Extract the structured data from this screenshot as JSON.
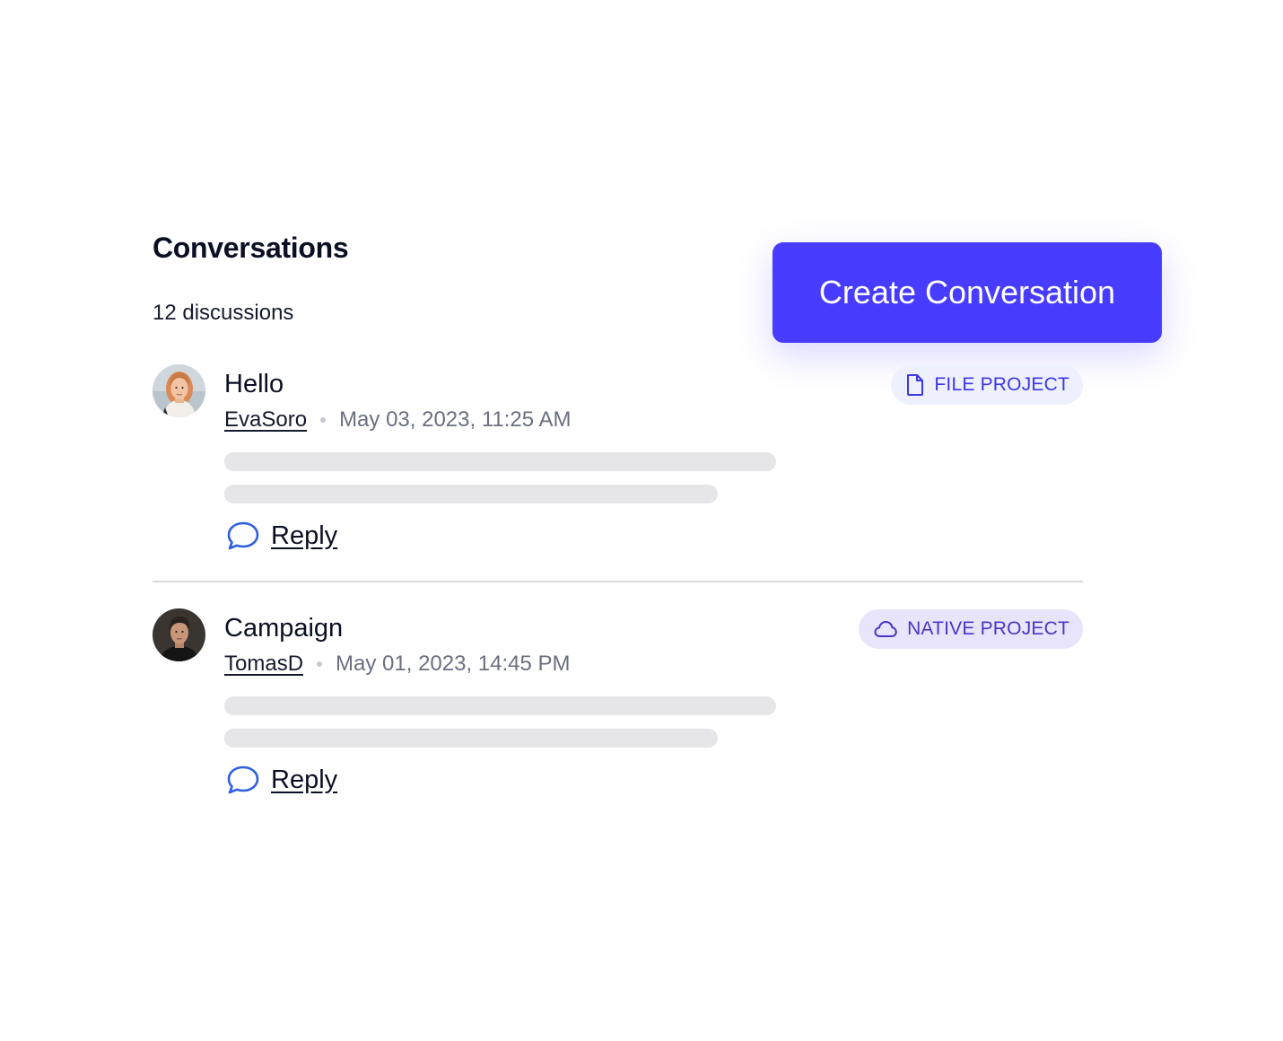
{
  "header": {
    "title": "Conversations",
    "count_label": "12 discussions",
    "create_button_label": "Create Conversation"
  },
  "colors": {
    "accent": "#473cff",
    "badge_file_bg": "#eef0fd",
    "badge_native_bg": "#e8e4fb",
    "reply_icon": "#2f5fe0",
    "skeleton": "#e6e6e8"
  },
  "conversations": [
    {
      "title": "Hello",
      "author": "EvaSoro",
      "timestamp": "May 03, 2023, 11:25 AM",
      "badge": {
        "label": "FILE PROJECT",
        "icon": "file-icon"
      },
      "reply_label": "Reply",
      "avatar": "avatar-woman"
    },
    {
      "title": "Campaign",
      "author": "TomasD",
      "timestamp": "May 01, 2023, 14:45 PM",
      "badge": {
        "label": "NATIVE PROJECT",
        "icon": "cloud-icon"
      },
      "reply_label": "Reply",
      "avatar": "avatar-man"
    }
  ]
}
